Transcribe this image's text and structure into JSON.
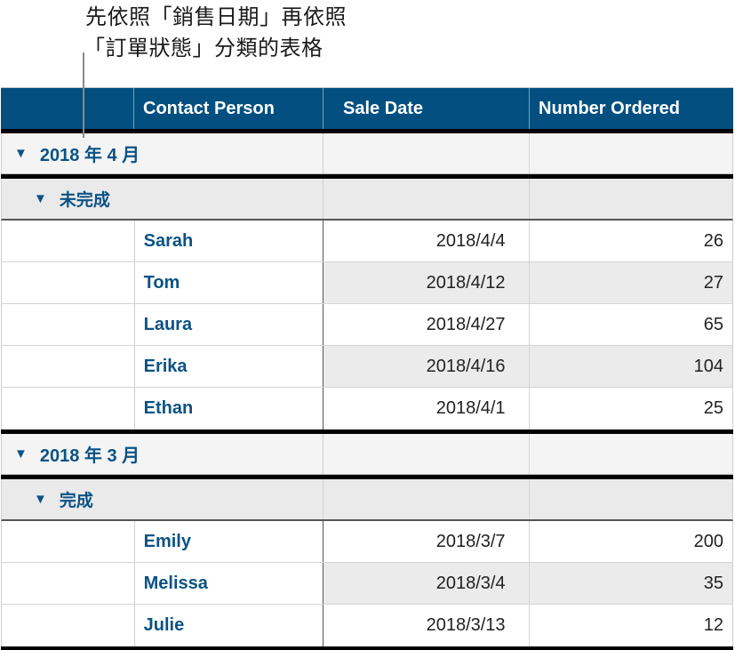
{
  "caption": {
    "line1": "先依照「銷售日期」再依照",
    "line2": "「訂單狀態」分類的表格"
  },
  "colors": {
    "header_bg": "#024f80",
    "header_text": "#ffffff",
    "accent_text": "#0b5285",
    "group_bg": "#f4f4f4",
    "subgroup_bg": "#eaeaea",
    "alt_row_bg": "#ebebeb"
  },
  "table": {
    "columns": [
      "",
      "Contact Person",
      "Sale Date",
      "Number Ordered"
    ],
    "groups": [
      {
        "label": "2018 年 4 月",
        "icon": "disclosure-triangle-down",
        "subgroups": [
          {
            "label": "未完成",
            "icon": "disclosure-triangle-down",
            "rows": [
              {
                "contact": "Sarah",
                "date": "2018/4/4",
                "ordered": "26"
              },
              {
                "contact": "Tom",
                "date": "2018/4/12",
                "ordered": "27"
              },
              {
                "contact": "Laura",
                "date": "2018/4/27",
                "ordered": "65"
              },
              {
                "contact": "Erika",
                "date": "2018/4/16",
                "ordered": "104"
              },
              {
                "contact": "Ethan",
                "date": "2018/4/1",
                "ordered": "25"
              }
            ]
          }
        ]
      },
      {
        "label": "2018 年 3 月",
        "icon": "disclosure-triangle-down",
        "subgroups": [
          {
            "label": "完成",
            "icon": "disclosure-triangle-down",
            "rows": [
              {
                "contact": "Emily",
                "date": "2018/3/7",
                "ordered": "200"
              },
              {
                "contact": "Melissa",
                "date": "2018/3/4",
                "ordered": "35"
              },
              {
                "contact": "Julie",
                "date": "2018/3/13",
                "ordered": "12"
              }
            ]
          }
        ]
      }
    ]
  }
}
